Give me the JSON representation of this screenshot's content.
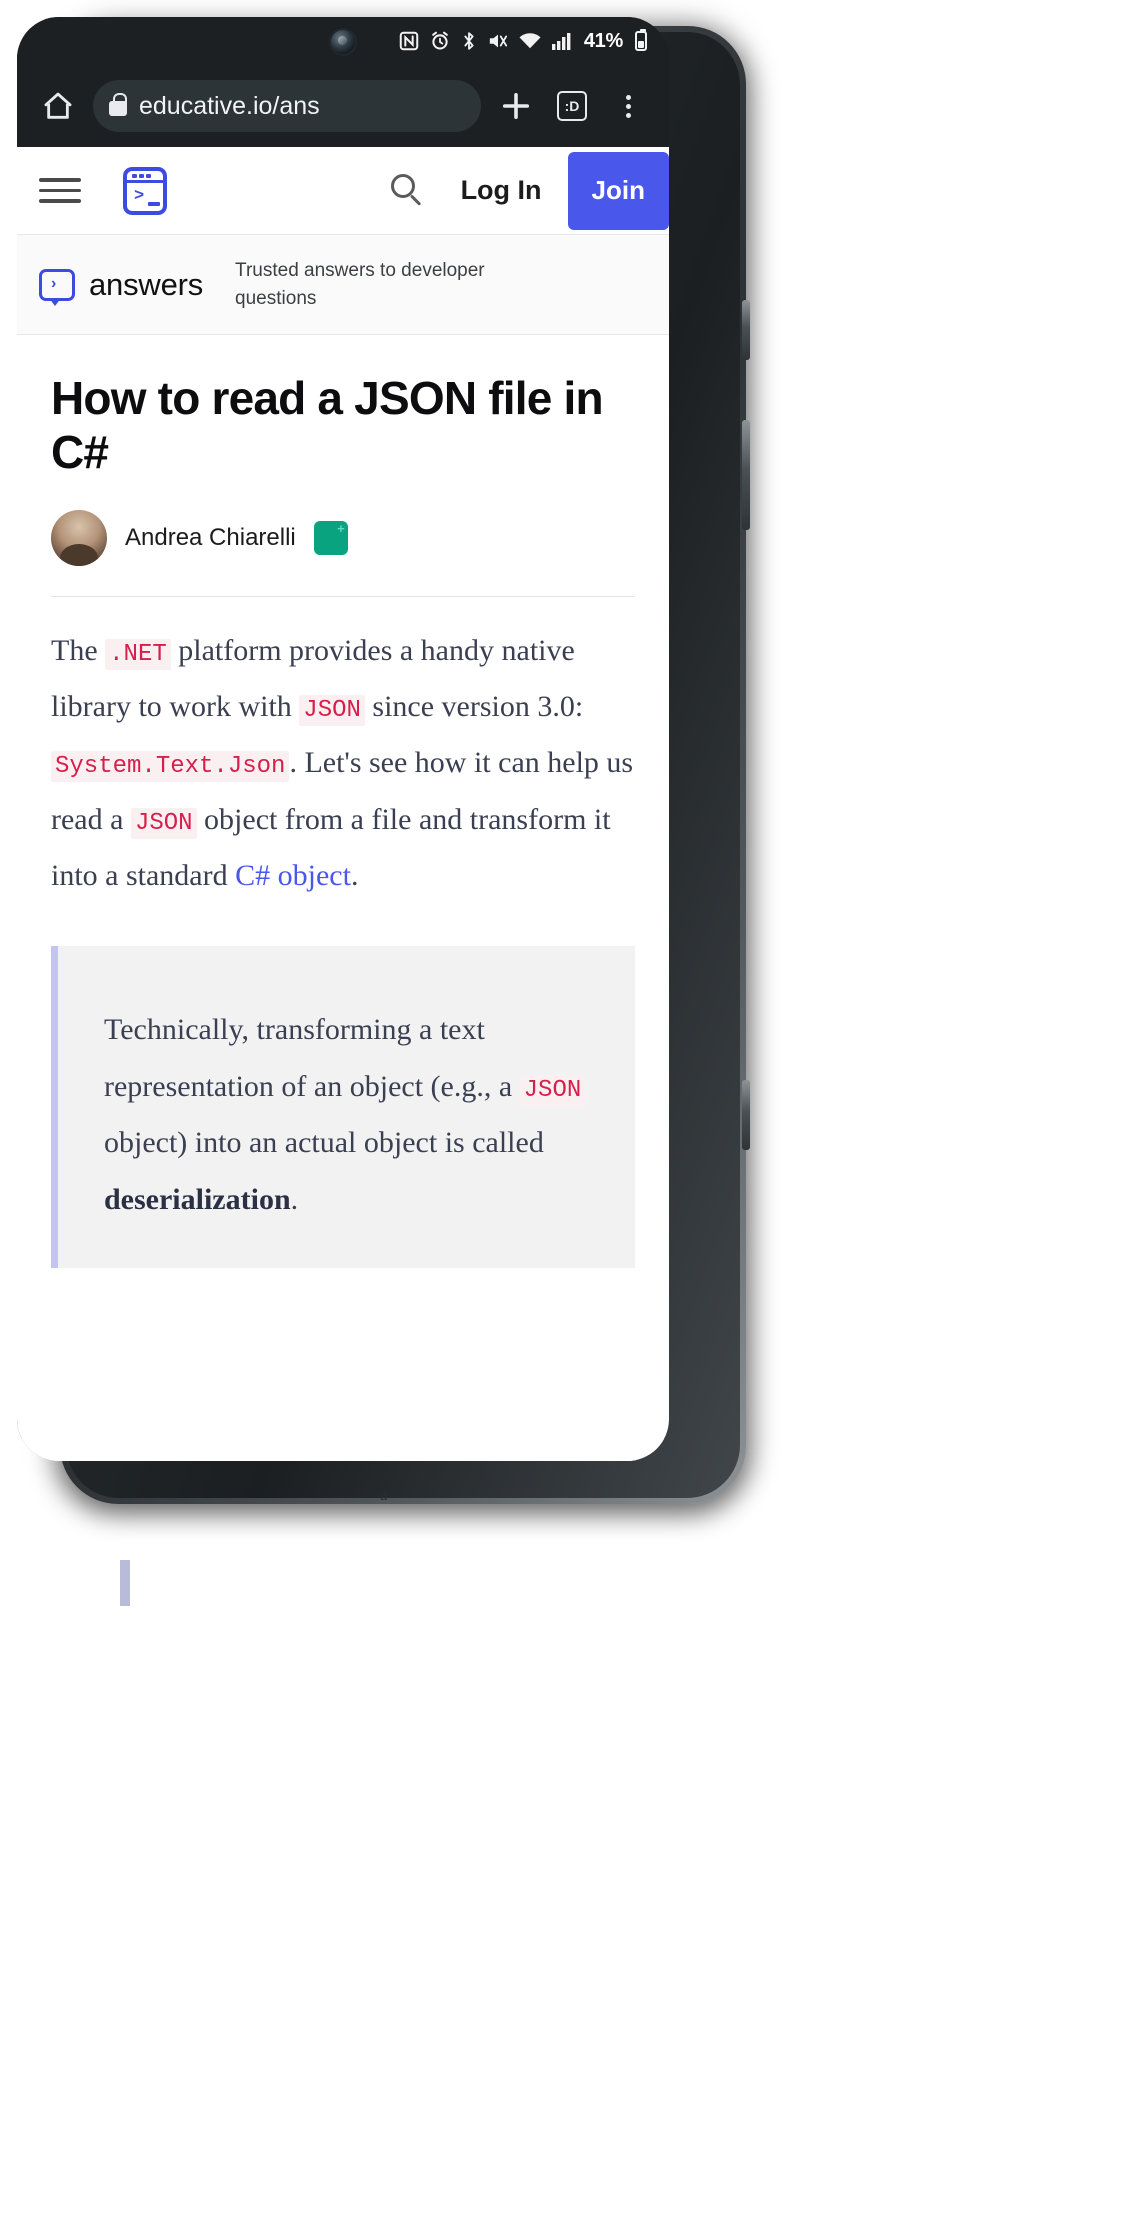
{
  "device": {
    "type": "android-phone",
    "statusbar": {
      "icons": [
        "nfc-icon",
        "alarm-icon",
        "bluetooth-icon",
        "mute-icon",
        "wifi-icon",
        "signal-icon"
      ],
      "battery_percent": "41%"
    }
  },
  "browser": {
    "home_icon": "home-icon",
    "lock_icon": "lock-icon",
    "url": "educative.io/ans",
    "new_tab_label": "+",
    "tab_count": ":D",
    "menu_icon": "kebab-menu-icon"
  },
  "site_header": {
    "menu_icon": "hamburger-icon",
    "logo": "educative-terminal-logo",
    "search_icon": "search-icon",
    "login_label": "Log In",
    "join_label": "Join",
    "join_color": "#4a57eb"
  },
  "answers_bar": {
    "logo_icon": "answers-speech-bubble-icon",
    "wordmark": "answers",
    "tagline": "Trusted answers to developer questions"
  },
  "article": {
    "title": "How to read a JSON file in C#",
    "author": "Andrea Chiarelli",
    "badge": "verified-badge",
    "paragraph": {
      "p1": "The ",
      "c1": ".NET",
      "p2": " platform provides a handy native library to work with ",
      "c2": "JSON",
      "p3": " since version 3.0: ",
      "c3": "System.Text.Json",
      "p4": ". Let's see how it can help us read a ",
      "c4": "JSON",
      "p5": " object from a file and transform it into a standard ",
      "link": "C# object",
      "p6": "."
    },
    "quote": {
      "q1": "Technically, transforming a text representation of an object (e.g., a ",
      "qc1": "JSON",
      "q2": " object) into an actual object is called ",
      "qbold": "deserialization",
      "q3": "."
    },
    "colors": {
      "code_text": "#d6204b",
      "code_bg": "#faf0f2",
      "link": "#4a57eb",
      "body": "#3a3f52",
      "quote_bg": "#f2f2f3",
      "quote_border": "#c3c4f0"
    }
  }
}
